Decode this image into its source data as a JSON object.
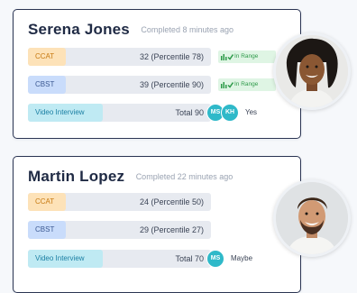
{
  "candidates": [
    {
      "name": "Serena Jones",
      "completed": "Completed 8 minutes ago",
      "ccat": {
        "label": "CCAT",
        "value": "32 (Percentile 78)",
        "badge": "In Range"
      },
      "cbst": {
        "label": "CBST",
        "value": "39 (Percentile 90)",
        "badge": "In Range"
      },
      "video": {
        "label": "Video Interview",
        "value": "Total 90",
        "reviewers": [
          "MS",
          "KH"
        ],
        "decision": "Yes"
      }
    },
    {
      "name": "Martin Lopez",
      "completed": "Completed 22 minutes ago",
      "ccat": {
        "label": "CCAT",
        "value": "24 (Percentile 50)"
      },
      "cbst": {
        "label": "CBST",
        "value": "29 (Percentile 27)"
      },
      "video": {
        "label": "Video Interview",
        "value": "Total 70",
        "reviewers": [
          "MS"
        ],
        "decision": "Maybe"
      }
    }
  ],
  "colors": {
    "ccat": "#fde2b8",
    "cbst": "#c9dcfb",
    "video": "#bfeaf3",
    "in_range": "#2e9a49",
    "reviewer": "#2fb9c9",
    "border": "#2b3553"
  }
}
